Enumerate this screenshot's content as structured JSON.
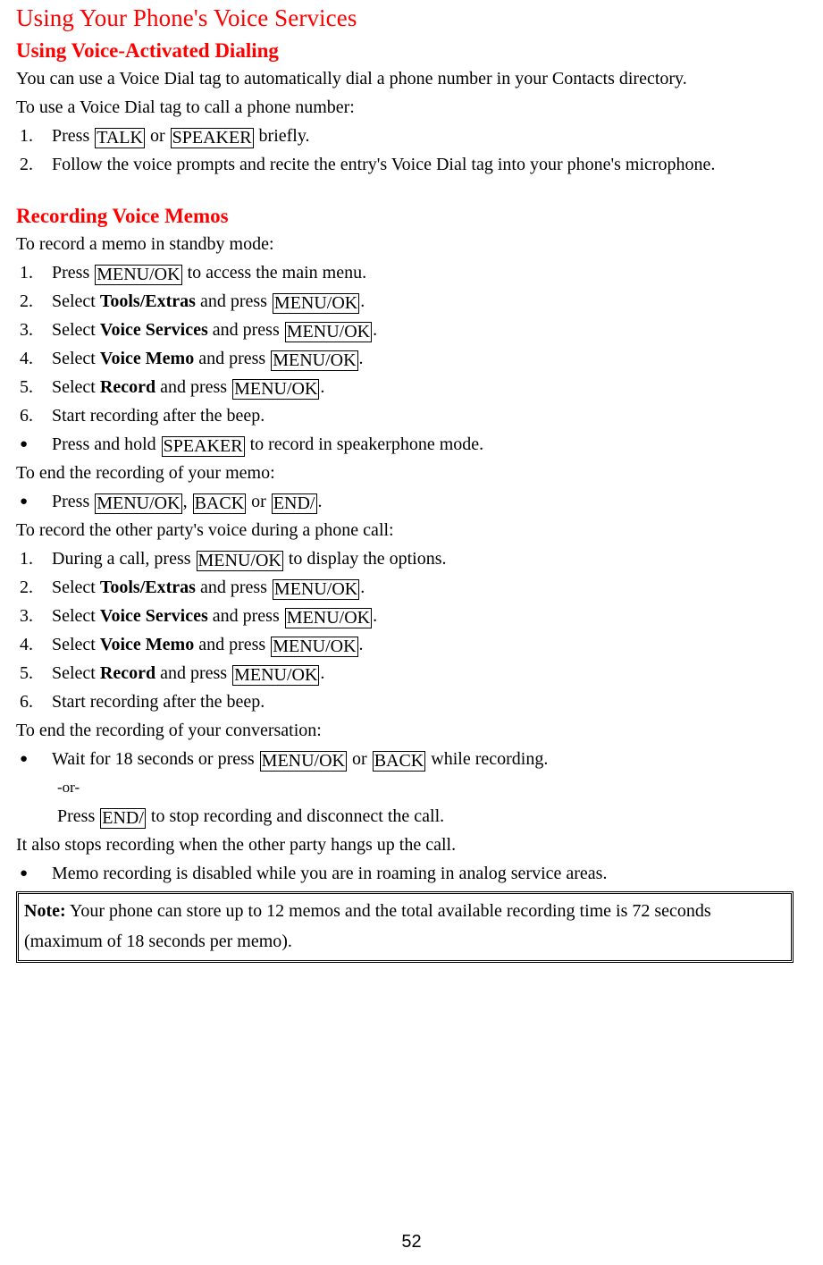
{
  "document": {
    "title": "Using Your Phone's Voice Services",
    "page_number": "52",
    "heading_color": "#ff0000",
    "text_color": "#000000",
    "background_color": "#ffffff"
  },
  "sections": {
    "voice_dialing": {
      "heading": "Using Voice-Activated Dialing",
      "intro": "You can use a Voice Dial tag to automatically dial a phone number in your Contacts directory.",
      "lead_in": "To use a Voice Dial tag to call a phone number:",
      "step1": {
        "marker": "1.",
        "before": "Press",
        "key1": "TALK",
        "middle": "or",
        "key2": "SPEAKER",
        "after": "briefly."
      },
      "step2": {
        "marker": "2.",
        "text": "Follow the voice prompts and recite the entry's Voice Dial tag into your phone's microphone."
      }
    },
    "recording_memos": {
      "heading": "Recording Voice Memos",
      "standby": {
        "lead_in": "To record a memo in standby mode:",
        "steps": [
          {
            "marker": "1.",
            "before": "Press",
            "key": "MENU/OK",
            "after": "to access the main menu."
          },
          {
            "marker": "2.",
            "before": "Select",
            "bold": "Tools/Extras",
            "mid": "and press",
            "key": "MENU/OK",
            "after": "."
          },
          {
            "marker": "3.",
            "before": "Select",
            "bold": "Voice Services",
            "mid": "and press",
            "key": "MENU/OK",
            "after": "."
          },
          {
            "marker": "4.",
            "before": "Select",
            "bold": "Voice Memo",
            "mid": "and press",
            "key": "MENU/OK",
            "after": "."
          },
          {
            "marker": "5.",
            "before": "Select",
            "bold": "Record",
            "mid": "and press",
            "key": "MENU/OK",
            "after": "."
          },
          {
            "marker": "6.",
            "before": "Start recording after the beep.",
            "bold": "",
            "mid": "",
            "key": "",
            "after": ""
          }
        ],
        "speaker_bullet": {
          "marker": "●",
          "before": "Press and hold",
          "key": "SPEAKER",
          "after": "to record in speakerphone mode."
        }
      },
      "end_memo": {
        "lead_in": "To end the recording of your memo:",
        "bullet": {
          "marker": "●",
          "before": "Press",
          "key1": "MENU/OK",
          "sep1": ",",
          "key2": "BACK",
          "mid": "or",
          "key3": "END/",
          "after": "."
        }
      },
      "during_call": {
        "lead_in": "To record the other party's voice during a phone call:",
        "steps": [
          {
            "marker": "1.",
            "before": "During a call, press",
            "bold": "",
            "mid": "",
            "key": "MENU/OK",
            "after": "to display the options."
          },
          {
            "marker": "2.",
            "before": "Select",
            "bold": "Tools/Extras",
            "mid": "and press",
            "key": "MENU/OK",
            "after": "."
          },
          {
            "marker": "3.",
            "before": "Select",
            "bold": "Voice Services",
            "mid": "and press",
            "key": "MENU/OK",
            "after": "."
          },
          {
            "marker": "4.",
            "before": "Select",
            "bold": "Voice Memo",
            "mid": "and press",
            "key": "MENU/OK",
            "after": "."
          },
          {
            "marker": "5.",
            "before": "Select",
            "bold": "Record",
            "mid": "and press",
            "key": "MENU/OK",
            "after": "."
          },
          {
            "marker": "6.",
            "before": "Start recording after the beep.",
            "bold": "",
            "mid": "",
            "key": "",
            "after": ""
          }
        ]
      },
      "end_conversation": {
        "lead_in": "To end the recording of your conversation:",
        "bullet": {
          "marker": "●",
          "before": "Wait for 18 seconds or press",
          "key1": "MENU/OK",
          "mid": "or",
          "key2": "BACK",
          "after": "while recording."
        },
        "or_label": "-or-",
        "alt": {
          "before": "Press",
          "key": "END/",
          "after": "to stop recording and disconnect the call."
        },
        "also": "It also stops recording when the other party hangs up the call.",
        "roaming_bullet": {
          "marker": "●",
          "text": "Memo recording is disabled while you are in roaming in analog service areas."
        }
      },
      "note": {
        "label": "Note:",
        "text": "Your phone can store up to 12 memos and the total available recording time is 72 seconds (maximum of 18 seconds per memo)."
      }
    }
  }
}
